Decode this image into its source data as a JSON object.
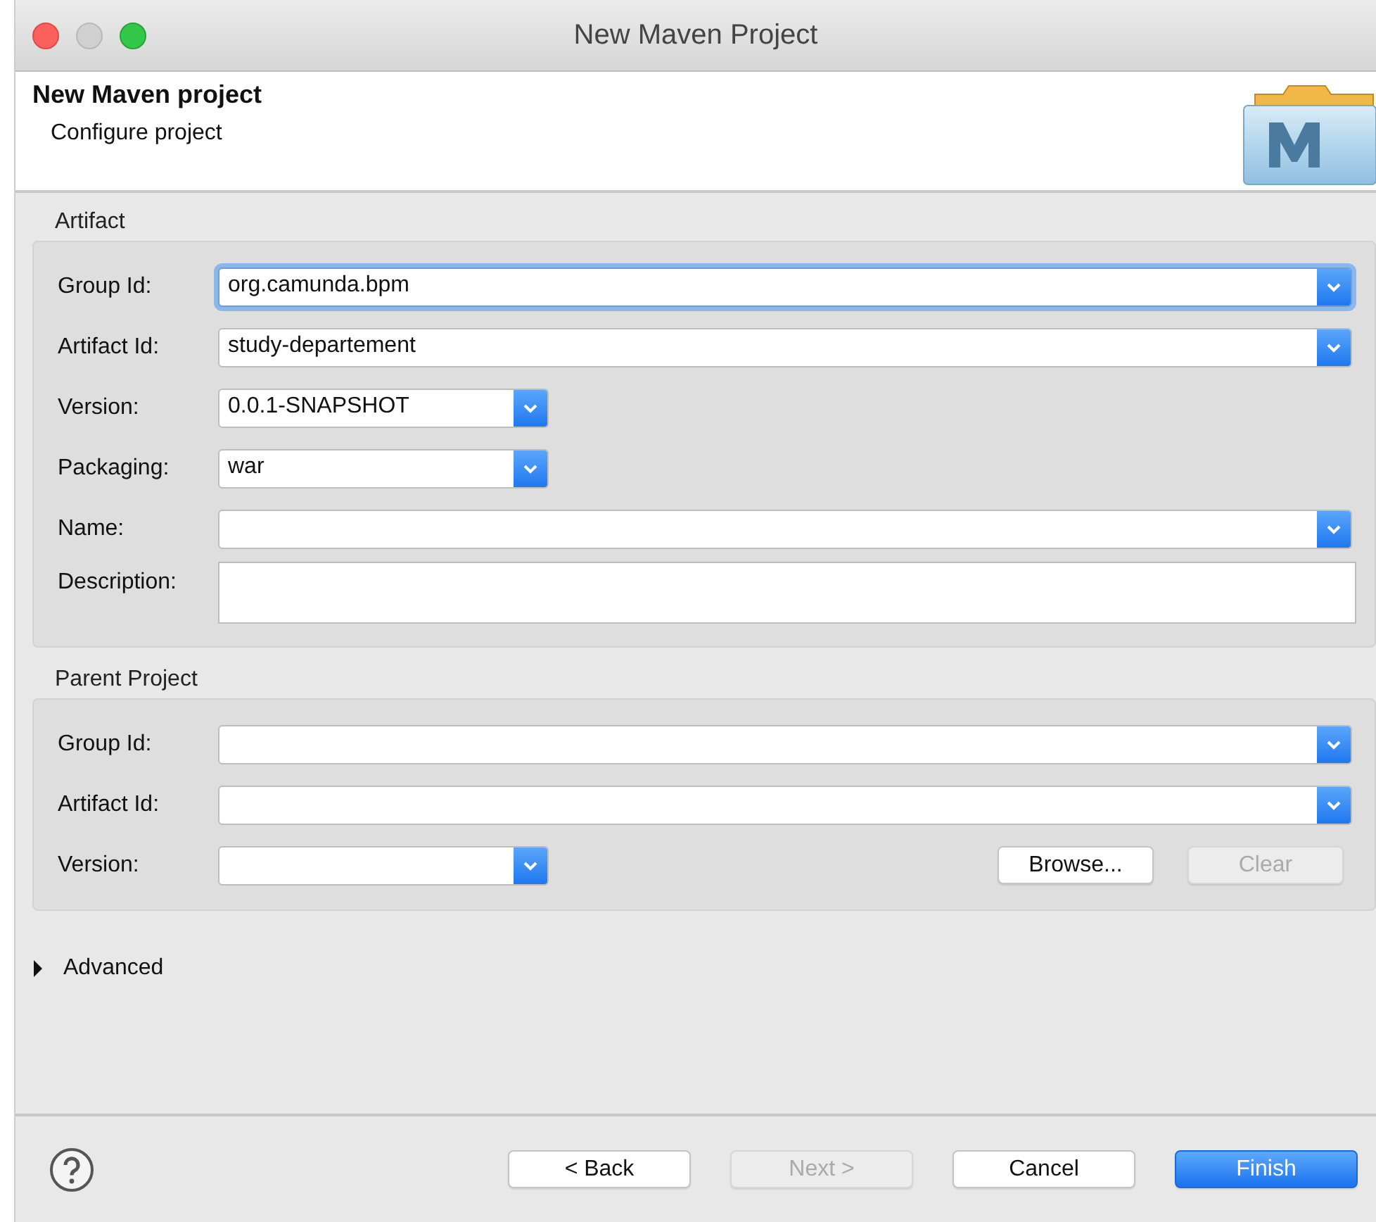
{
  "window": {
    "title": "New Maven Project"
  },
  "header": {
    "title": "New Maven project",
    "subtitle": "Configure project"
  },
  "groups": [
    {
      "title": "Artifact",
      "fields": [
        {
          "label": "Group Id:",
          "kind": "combo",
          "value": "org.camunda.bpm",
          "focused": true
        },
        {
          "label": "Artifact Id:",
          "kind": "combo",
          "value": "study-departement",
          "focused": false
        },
        {
          "label": "Version:",
          "kind": "short-combo",
          "value": "0.0.1-SNAPSHOT",
          "focused": false
        },
        {
          "label": "Packaging:",
          "kind": "short-combo",
          "value": "war",
          "focused": false
        },
        {
          "label": "Name:",
          "kind": "combo",
          "focused": false
        },
        {
          "label": "Description:",
          "kind": "memo",
          "focused": false
        }
      ]
    },
    {
      "title": "Parent Project",
      "fields": [
        {
          "label": "Group Id:",
          "kind": "combo",
          "focused": false
        },
        {
          "label": "Artifact Id:",
          "kind": "combo",
          "focused": false
        },
        {
          "label": "Version:",
          "kind": "short-combo",
          "focused": false
        }
      ],
      "buttons": [
        {
          "label": "Browse...",
          "disabled": false
        },
        {
          "label": "Clear",
          "disabled": true
        }
      ]
    }
  ],
  "advanced": {
    "label": "Advanced",
    "expanded": false
  },
  "footer_buttons": [
    {
      "label": "< Back",
      "disabled": false,
      "default": false
    },
    {
      "label": "Next >",
      "disabled": true,
      "default": false
    },
    {
      "label": "Cancel",
      "disabled": false,
      "default": false
    },
    {
      "label": "Finish",
      "disabled": false,
      "default": true
    }
  ]
}
